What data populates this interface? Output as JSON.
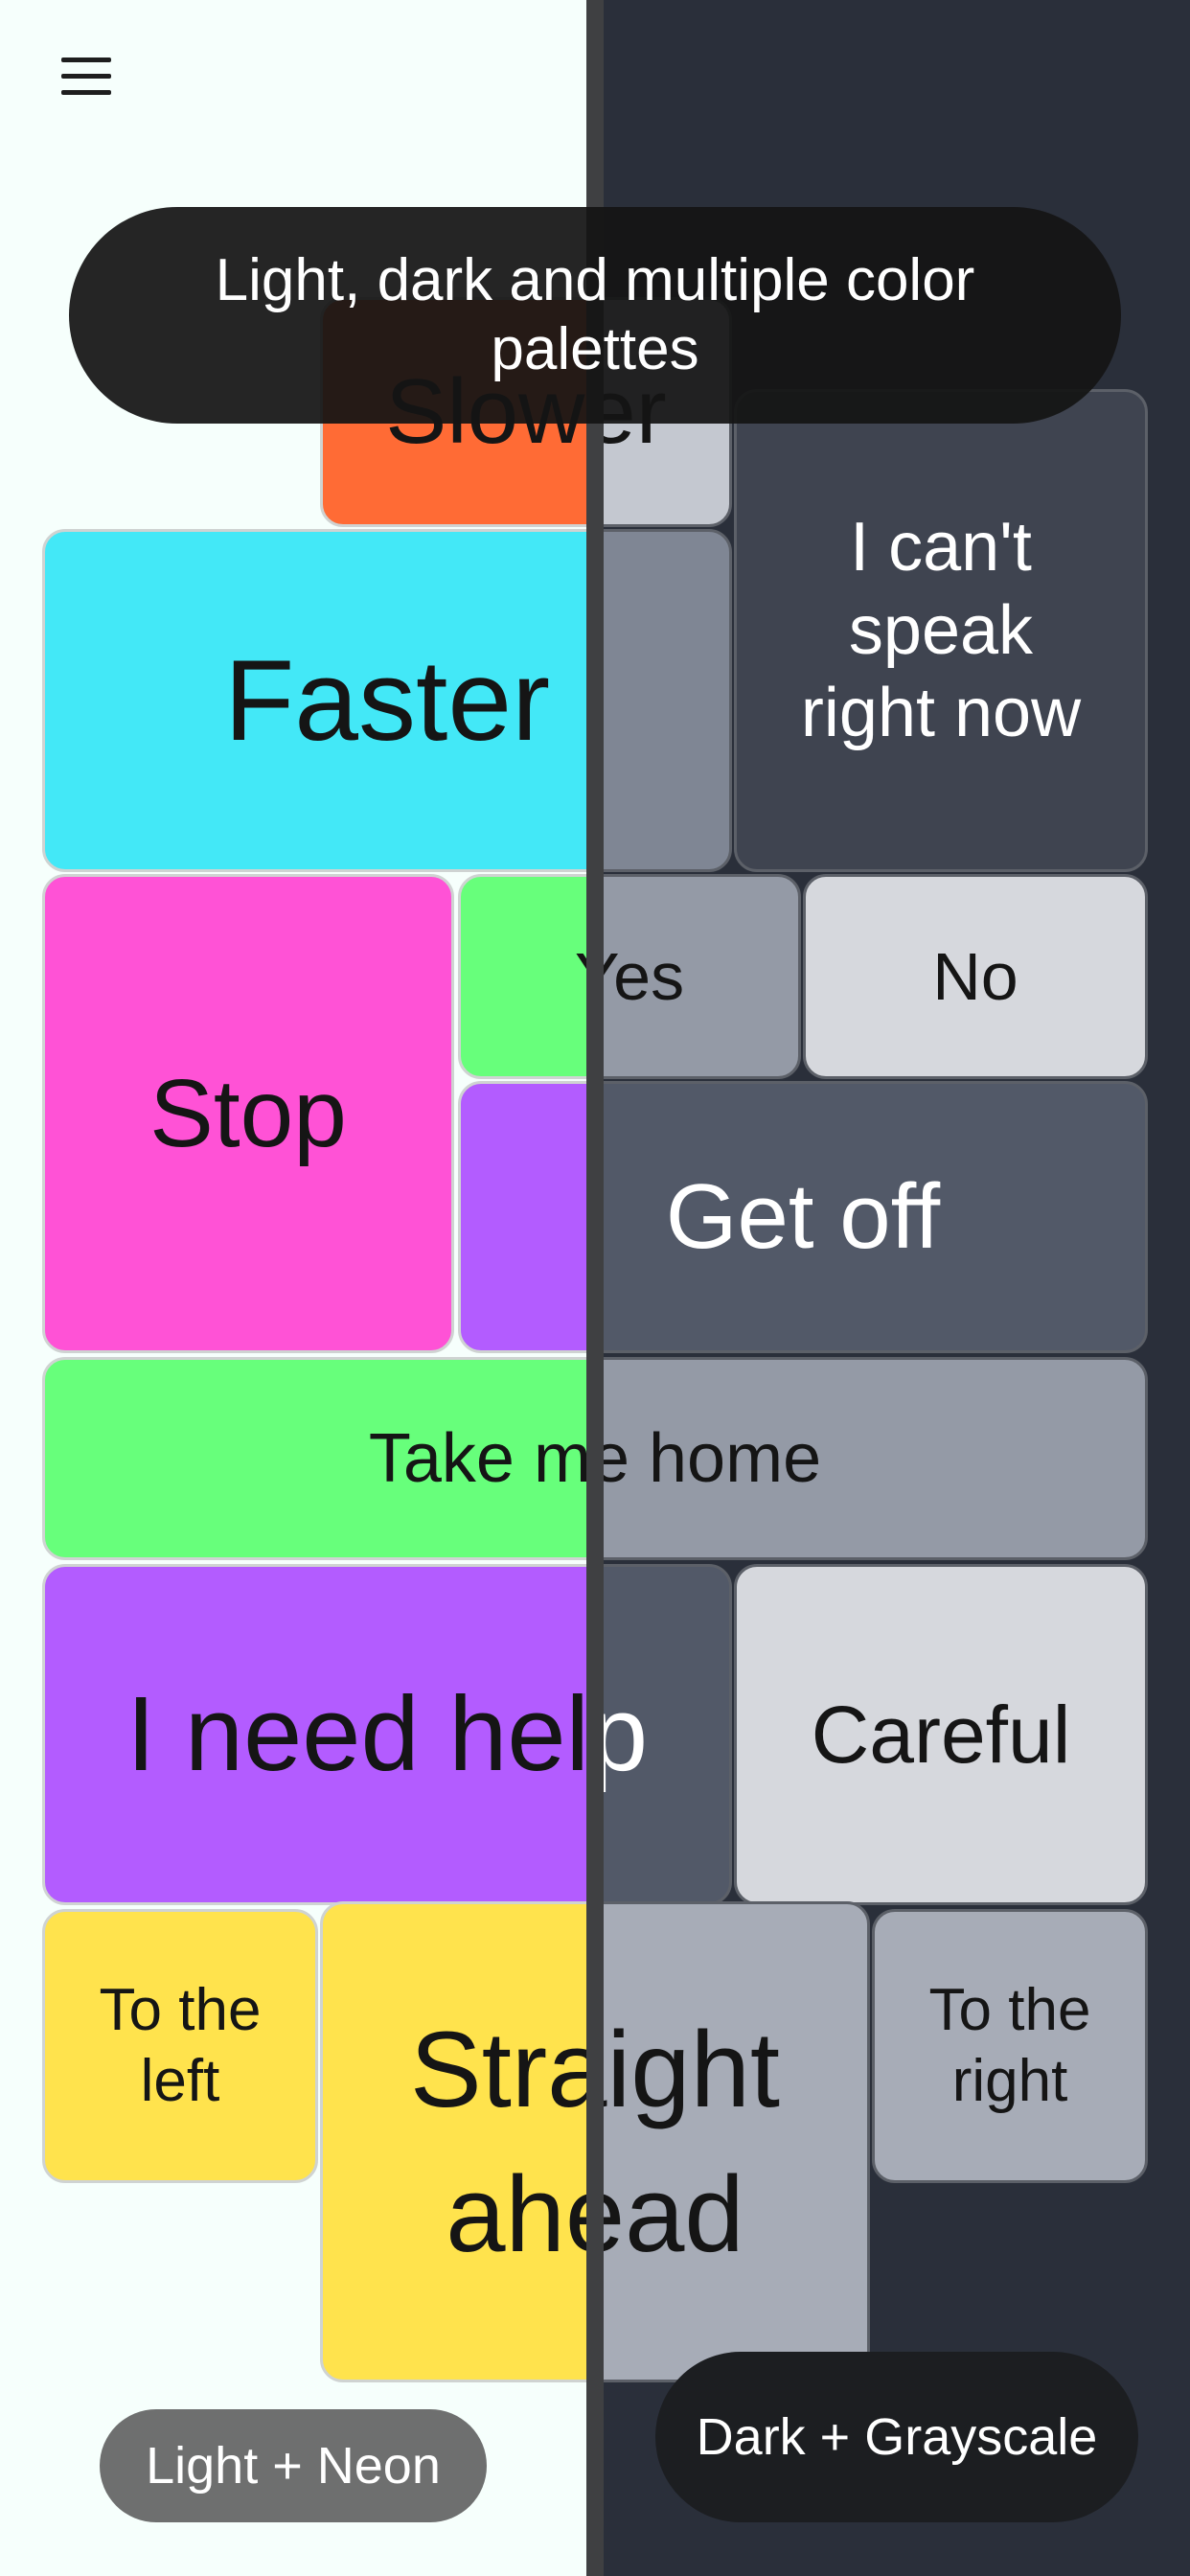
{
  "banner": {
    "text": "Light, dark and multiple color palettes"
  },
  "menu": {
    "icon": "hamburger-menu-icon"
  },
  "tiles": [
    {
      "id": "slower",
      "label": "Slower",
      "light_color": "#ff6b35",
      "dark_color": "#c4c8d0",
      "dark_text_light": false
    },
    {
      "id": "cant-speak",
      "label": "I can't speak right now",
      "light_color": "#3f4450",
      "dark_color": "#3f4450",
      "dark_text_light": true
    },
    {
      "id": "faster",
      "label": "Faster",
      "light_color": "#43e8f7",
      "dark_color": "#7f8694",
      "dark_text_light": false
    },
    {
      "id": "stop",
      "label": "Stop",
      "light_color": "#ff52d6",
      "dark_color": "#7f8694",
      "dark_text_light": false
    },
    {
      "id": "yes",
      "label": "Yes",
      "light_color": "#67ff7b",
      "dark_color": "#949aa6",
      "dark_text_light": false
    },
    {
      "id": "no",
      "label": "No",
      "light_color": "#d6d8dd",
      "dark_color": "#d6d8dd",
      "dark_text_light": false
    },
    {
      "id": "get-off",
      "label": "Get off",
      "light_color": "#b35cff",
      "dark_color": "#525968",
      "dark_text_light": true
    },
    {
      "id": "take-me-home",
      "label": "Take me home",
      "light_color": "#67ff7b",
      "dark_color": "#949aa6",
      "dark_text_light": false
    },
    {
      "id": "need-help",
      "label": "I need help",
      "light_color": "#b35cff",
      "dark_color": "#525968",
      "dark_text_light": true
    },
    {
      "id": "careful",
      "label": "Careful",
      "light_color": "#d6d8dd",
      "dark_color": "#d6d8dd",
      "dark_text_light": false
    },
    {
      "id": "to-left",
      "label": "To the left",
      "light_color": "#ffe34d",
      "dark_color": "#a7acb7",
      "dark_text_light": false
    },
    {
      "id": "straight",
      "label": "Straight ahead",
      "light_color": "#ffe34d",
      "dark_color": "#a7acb7",
      "dark_text_light": false
    },
    {
      "id": "to-right",
      "label": "To the right",
      "light_color": "#a7acb7",
      "dark_color": "#a7acb7",
      "dark_text_light": false
    }
  ],
  "palettes": {
    "light_neon": "Light + Neon",
    "dark_grayscale": "Dark + Grayscale"
  }
}
